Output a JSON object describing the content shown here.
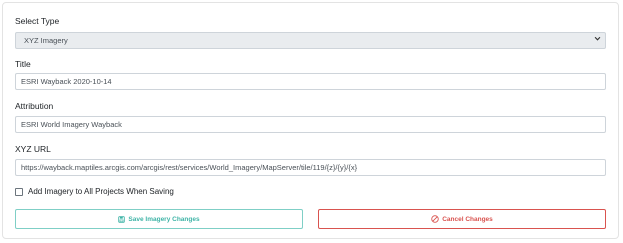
{
  "form": {
    "select_type": {
      "label": "Select Type",
      "value": "XYZ Imagery"
    },
    "title": {
      "label": "Title",
      "value": "ESRI Wayback 2020-10-14"
    },
    "attribution": {
      "label": "Attribution",
      "value": "ESRI World Imagery Wayback"
    },
    "xyz_url": {
      "label": "XYZ URL",
      "value": "https://wayback.maptiles.arcgis.com/arcgis/rest/services/World_Imagery/MapServer/tile/119/{z}/{y}/{x}"
    },
    "add_to_all": {
      "label": "Add Imagery to All Projects When Saving",
      "checked": false
    }
  },
  "buttons": {
    "save_label": "Save Imagery Changes",
    "cancel_label": "Cancel Changes"
  },
  "colors": {
    "save_accent": "#3fb4a7",
    "cancel_accent": "#d9534f",
    "select_background": "#e9ecef"
  },
  "icons": {
    "save": "save-icon",
    "cancel": "cancel-icon",
    "dropdown": "chevron-down-icon"
  }
}
